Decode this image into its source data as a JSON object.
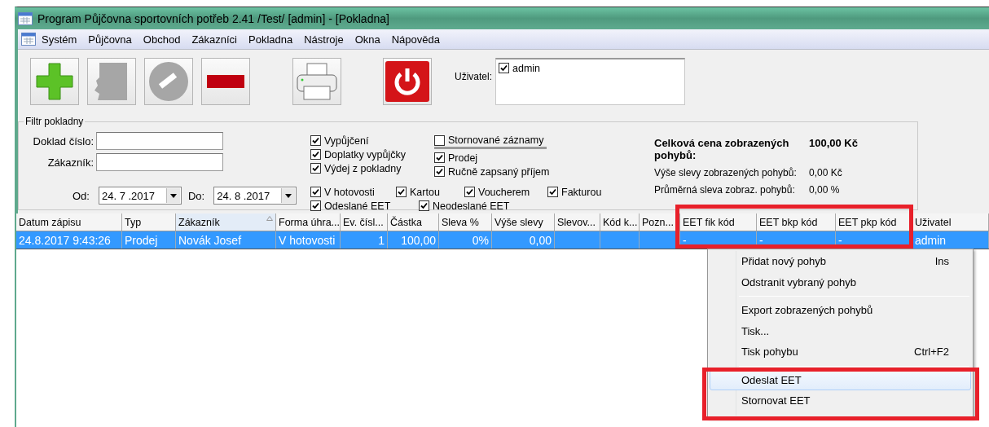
{
  "window": {
    "title": "Program Půjčovna sportovních potřeb 2.41 /Test/ [admin] - [Pokladna]"
  },
  "menu": [
    {
      "label": "Systém"
    },
    {
      "label": "Půjčovna"
    },
    {
      "label": "Obchod"
    },
    {
      "label": "Zákazníci"
    },
    {
      "label": "Pokladna"
    },
    {
      "label": "Nástroje"
    },
    {
      "label": "Okna"
    },
    {
      "label": "Nápověda"
    }
  ],
  "toolbar": {
    "buttons": [
      {
        "kind": "add",
        "disabled": false
      },
      {
        "kind": "edit",
        "disabled": true
      },
      {
        "kind": "cancel",
        "disabled": true
      },
      {
        "kind": "remove",
        "disabled": false
      },
      {
        "kind": "print",
        "disabled": false
      },
      {
        "kind": "power",
        "disabled": false
      }
    ],
    "user_label": "Uživatel:",
    "users": [
      {
        "label": "admin",
        "checked": true
      }
    ]
  },
  "filter": {
    "title": "Filtr pokladny",
    "fields": [
      {
        "label": "Doklad číslo:"
      },
      {
        "label": "Zákazník:"
      }
    ],
    "date_from": {
      "label": "Od:",
      "value": "24. 7 .2017"
    },
    "date_to": {
      "label": "Do:",
      "value": "24. 8 .2017"
    },
    "types_left": [
      {
        "label": "Vypůjčení",
        "checked": true
      },
      {
        "label": "Doplatky vypůjčky",
        "checked": true
      },
      {
        "label": "Výdej z pokladny",
        "checked": true
      }
    ],
    "types_right": [
      {
        "kind": "header",
        "label": "Stornované záznamy",
        "checked": false
      },
      {
        "kind": "option",
        "label": "Prodej",
        "checked": true
      },
      {
        "kind": "option",
        "label": "Ručně zapsaný příjem",
        "checked": true
      }
    ],
    "payments": [
      {
        "label": "V hotovosti",
        "checked": true
      },
      {
        "label": "Kartou",
        "checked": true
      },
      {
        "label": "Voucherem",
        "checked": true
      },
      {
        "label": "Fakturou",
        "checked": true
      }
    ],
    "eet": [
      {
        "label": "Odeslané EET",
        "checked": true
      },
      {
        "label": "Neodeslané EET",
        "checked": true
      }
    ],
    "summary": [
      {
        "label": "Celková cena zobrazených pohybů:",
        "value": "100,00 Kč",
        "bold": true
      },
      {
        "label": "Výše slevy zobrazených pohybů:",
        "value": "0,00 Kč",
        "bold": false
      },
      {
        "label": "Průměrná sleva zobraz. pohybů:",
        "value": "0,00 %",
        "bold": false
      }
    ]
  },
  "table": {
    "columns": [
      {
        "label": "Datum zápisu",
        "sorted": false
      },
      {
        "label": "Typ",
        "sorted": false
      },
      {
        "label": "Zákazník",
        "sorted": true
      },
      {
        "label": "Forma úhra...",
        "sorted": false
      },
      {
        "label": "Ev. čísl...",
        "sorted": false
      },
      {
        "label": "Částka",
        "sorted": false
      },
      {
        "label": "Sleva %",
        "sorted": false
      },
      {
        "label": "Výše slevy",
        "sorted": false
      },
      {
        "label": "Slevov...",
        "sorted": false
      },
      {
        "label": "Kód k...",
        "sorted": false
      },
      {
        "label": "Pozn...",
        "sorted": false
      },
      {
        "label": "EET fik kód",
        "sorted": false
      },
      {
        "label": "EET bkp kód",
        "sorted": false
      },
      {
        "label": "EET pkp kód",
        "sorted": false
      },
      {
        "label": "Uživatel",
        "sorted": false
      }
    ],
    "rows": [
      {
        "selected": true,
        "cells": [
          "24.8.2017 9:43:26",
          "Prodej",
          "Novák Josef",
          "V hotovosti",
          "1",
          "100,00",
          "0%",
          "0,00",
          null,
          null,
          null,
          "-",
          "-",
          "-",
          "admin"
        ]
      }
    ]
  },
  "context_menu": {
    "groups": [
      [
        {
          "label": "Přidat nový pohyb",
          "shortcut": "Ins",
          "selected": false
        },
        {
          "label": "Odstranit vybraný pohyb",
          "selected": false
        }
      ],
      [
        {
          "label": "Export zobrazených pohybů",
          "selected": false
        },
        {
          "label": "Tisk...",
          "selected": false
        },
        {
          "label": "Tisk pohybu",
          "shortcut": "Ctrl+F2",
          "selected": false
        }
      ],
      [
        {
          "label": "Odeslat EET",
          "selected": true
        },
        {
          "label": "Stornovat EET",
          "selected": false
        }
      ]
    ]
  }
}
